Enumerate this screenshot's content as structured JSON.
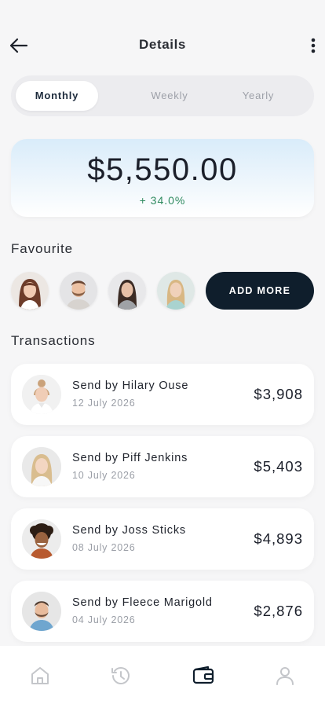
{
  "header": {
    "title": "Details",
    "back_icon": "arrow-left-icon",
    "more_icon": "more-vertical-icon"
  },
  "period_tabs": {
    "options": [
      "Monthly",
      "Weekly",
      "Yearly"
    ],
    "selected": "Monthly"
  },
  "balance": {
    "amount": "$5,550.00",
    "change": "+ 34.0%",
    "change_color": "#2f8a5f"
  },
  "favourites": {
    "title": "Favourite",
    "contacts": [
      "woman-long-brown-hair",
      "man-beard",
      "woman-dark-hair",
      "woman-blonde"
    ],
    "add_label": "ADD MORE"
  },
  "transactions": {
    "title": "Transactions",
    "items": [
      {
        "name": "Send by Hilary Ouse",
        "date": "12 July 2026",
        "amount": "$3,908"
      },
      {
        "name": "Send by Piff Jenkins",
        "date": "10 July 2026",
        "amount": "$5,403"
      },
      {
        "name": "Send by Joss Sticks",
        "date": "08 July 2026",
        "amount": "$4,893"
      },
      {
        "name": "Send by Fleece Marigold",
        "date": "04 July 2026",
        "amount": "$2,876"
      }
    ]
  },
  "tab_bar": {
    "items": [
      "home-icon",
      "history-icon",
      "wallet-icon",
      "profile-icon"
    ],
    "active": "wallet-icon"
  },
  "colors": {
    "accent_dark": "#0f1e2c",
    "background": "#f6f6f7",
    "card": "#ffffff"
  }
}
